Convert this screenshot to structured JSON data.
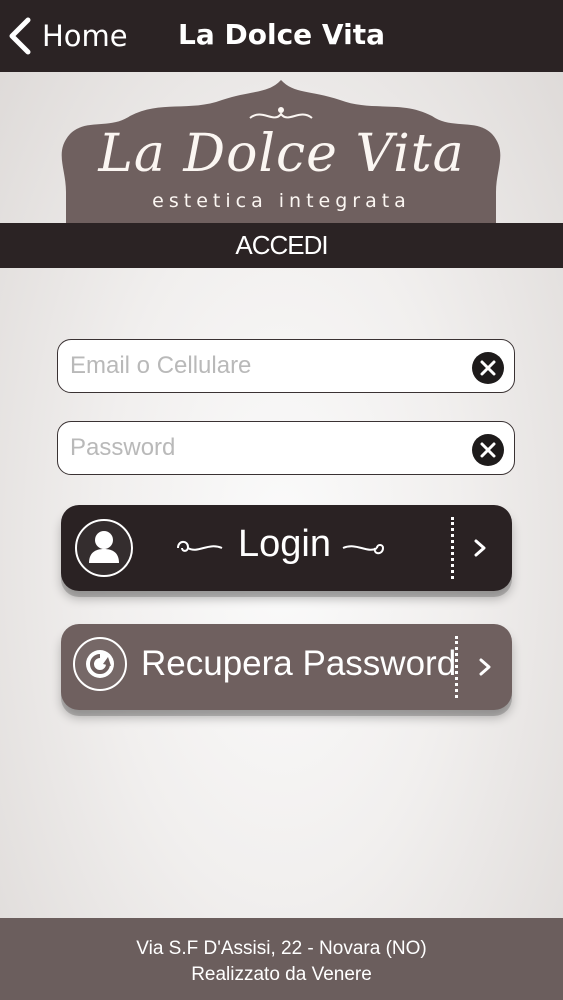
{
  "nav": {
    "back_label": "Home",
    "title": "La Dolce Vita"
  },
  "logo": {
    "title": "La Dolce Vita",
    "subtitle": "estetica integrata"
  },
  "section": {
    "title": "ACCEDI"
  },
  "form": {
    "email": {
      "placeholder": "Email o Cellulare",
      "value": ""
    },
    "password": {
      "placeholder": "Password",
      "value": ""
    }
  },
  "buttons": {
    "login": {
      "label": "Login",
      "icon": "user-icon"
    },
    "recover": {
      "label": "Recupera Password",
      "icon": "refresh-icon"
    }
  },
  "footer": {
    "address": "Via S.F D'Assisi, 22 - Novara (NO)",
    "credit": "Realizzato da Venere"
  },
  "colors": {
    "dark": "#2b2324",
    "brand_mauve": "#6f605f",
    "footer": "#6b5e5d",
    "text_light": "#ffffff"
  }
}
